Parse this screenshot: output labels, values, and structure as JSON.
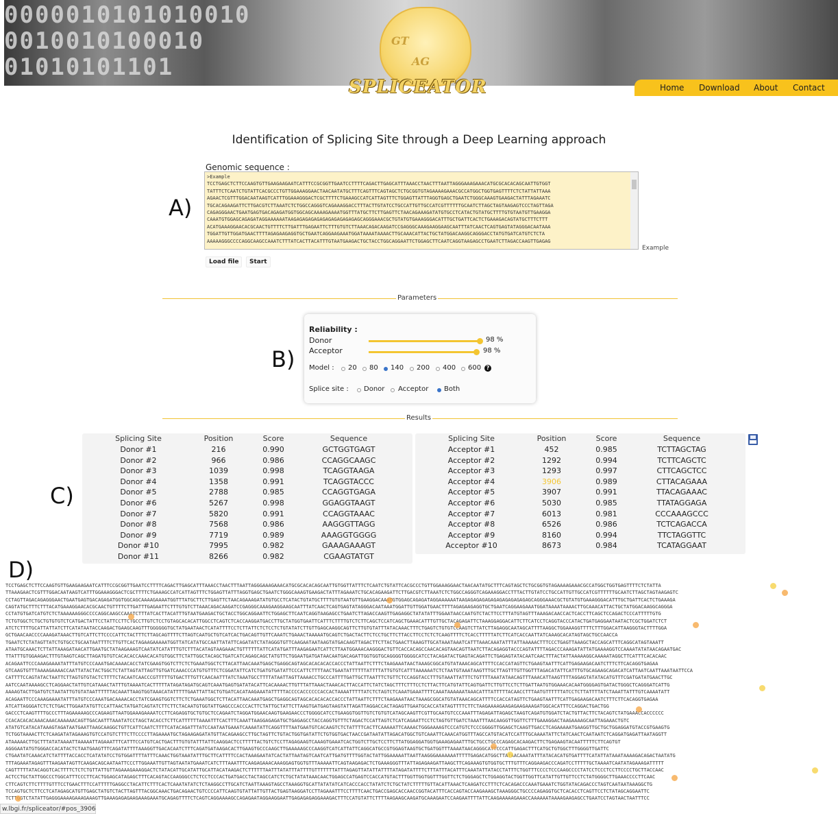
{
  "header": {
    "binary_lines": [
      "0000010101010010",
      "0010010100010",
      "01010101101"
    ],
    "logo_top": "GT",
    "logo_mid": "AG",
    "logo_text": "SPLICEATOR",
    "nav": [
      "Home",
      "Download",
      "About",
      "Contact"
    ],
    "colors": {
      "nav_bar": "#f8c21c"
    }
  },
  "title": "Identification of Splicing Site through a Deep Learning approach",
  "input": {
    "label": "Genomic sequence :",
    "value": ">Example\nTCCTGAGCTCTTCCAAGTGTTGAAGAAGAATCATTTCCGCGGTTGAATCCTTTTCAGACTTGAGCATTTAAACCTAACTTTAATTAGGGAAAGAAACATGCGCACACAGCAATTGTGGT\nTATTTCTCAATCTGTATTCACGCCCTGTTGGAAAGGAACTAACAATATGCTTTCAGTTTCAGTAGCTCTGCGGTGTAGAAAAGAAACGCCATGGCTGGTGAGTTTTCTCTATTATTAAA\nAGAACTCGTTTGGACAATAAGTCATTTGGAAAGGGACTCGCTTTTCTGAAAGCCATCATTAGTTTCTGGAGTTATTTAGGTGAGCTGAATCTGGGCAAAGTGAAGACTATTTAGAAATC\nTGCACAGAAGATTCTTGACGTCTTAAATCTCTGGCCAGGGTCAGAAAGGACCTTTACTTGTATCCTGCCATTGTTGCCATCGTTTTTTGCAATCTTAGCTAGTAAGAGTCCCTAGTTAGA\nCAGAGGGAACTGAATGAGTGACAGAGATGGTGGCAGCAAAAGAAAATGGTTTATGCTTCTTGAGTTCTAACAGAAAGATATGTGCCTCATACTGTATGCTTTTGTGTAATGTTGAAGGA\nCAAATGTGGAGCAGAGATAGGAAAAAATAAGAGAGAGAGAGAGAGAGAGAGAGCAGGGAAACGCTGTATGTGAAAGGGACATTTGCTGATTCACTCTGAAAGACAGTATGCTTTCTTT\nACATGAAAGGAACACGCAACTGTTTTCTTGATTTGAGAATTCTTTGTGTCTTAAACAGACAAGATCCGAGGGCAAAGAAGGAAGCAATTTATCAACTCAGTGAGTATAGGGACAATAAA\nTGGATTGTTGGATGAACTTTTAGAGAAGAGGTGCTGAATCAGGAAGAAATGGATAAAATAAAACTTGCAAACATTACTGCTATGGACAAGGCAGGGACCTATGTGATCATGTCTCTA\nAAAAAGGGCCCCAGGCAAGCCAAATCTTTATCACTTACATTTGTAATGAAGACTGCTACCTGGCAGGAATTCTGGAGCTTCAATCAGGTAAGAGCCTGAATCTTAGACCAAGTTGAGAG",
    "example_link": "Example",
    "load_button": "Load file",
    "start_button": "Start"
  },
  "parameters": {
    "section_label": "Parameters",
    "reliability_label": "Reliability :",
    "donor_label": "Donor",
    "donor_value": "98 %",
    "donor_pct": 98,
    "acceptor_label": "Acceptor",
    "acceptor_value": "98 %",
    "acceptor_pct": 98,
    "model_label": "Model :",
    "model_options": [
      "20",
      "80",
      "140",
      "200",
      "400",
      "600"
    ],
    "model_selected": "140",
    "splice_label": "Splice site :",
    "splice_options": [
      "Donor",
      "Acceptor",
      "Both"
    ],
    "splice_selected": "Both"
  },
  "results": {
    "section_label": "Results",
    "donor_headers": [
      "Splicing Site",
      "Position",
      "Score",
      "Sequence"
    ],
    "donor_rows": [
      [
        "Donor #1",
        "216",
        "0.990",
        "GCTGGTGAGT"
      ],
      [
        "Donor #2",
        "966",
        "0.986",
        "CCAGGCAAGC"
      ],
      [
        "Donor #3",
        "1039",
        "0.998",
        "TCAGGTAAGA"
      ],
      [
        "Donor #4",
        "1358",
        "0.991",
        "TCAGGTACCC"
      ],
      [
        "Donor #5",
        "2788",
        "0.985",
        "CCAGGTGAGA"
      ],
      [
        "Donor #6",
        "5267",
        "0.998",
        "GGAGGTAAGT"
      ],
      [
        "Donor #7",
        "5820",
        "0.991",
        "CCAGGTAAAC"
      ],
      [
        "Donor #8",
        "7568",
        "0.986",
        "AAGGGTTAGG"
      ],
      [
        "Donor #9",
        "7719",
        "0.989",
        "AAAGGTGGGG"
      ],
      [
        "Donor #10",
        "7995",
        "0.982",
        "GAAAGAAAGT"
      ],
      [
        "Donor #11",
        "8266",
        "0.982",
        "CGAAGTATGT"
      ]
    ],
    "acceptor_headers": [
      "Splicing Site",
      "Position",
      "Score",
      "Sequence"
    ],
    "acceptor_rows": [
      [
        "Acceptor #1",
        "452",
        "0.985",
        "TCTTAGCTAG"
      ],
      [
        "Acceptor #2",
        "1292",
        "0.994",
        "TCTTCAGCTC"
      ],
      [
        "Acceptor #3",
        "1293",
        "0.997",
        "CTTCAGCTCC"
      ],
      [
        "Acceptor #4",
        "3906",
        "0.989",
        "CTTACAGAAA"
      ],
      [
        "Acceptor #5",
        "3907",
        "0.991",
        "TTACAGAAAC"
      ],
      [
        "Acceptor #6",
        "5030",
        "0.985",
        "TTATAGGAGA"
      ],
      [
        "Acceptor #7",
        "6013",
        "0.981",
        "CCCAAAGCCC"
      ],
      [
        "Acceptor #8",
        "6526",
        "0.986",
        "TCTCAGACCA"
      ],
      [
        "Acceptor #9",
        "8160",
        "0.994",
        "TTCTAGGTTC"
      ],
      [
        "Acceptor #10",
        "8673",
        "0.984",
        "TCATAGGAAT"
      ]
    ],
    "highlight_color": "#f3c531"
  },
  "annotations": {
    "a": "A)",
    "b": "B)",
    "c": "C)",
    "d": "D)"
  },
  "dna_lines": [
    "TCCTGAGCTCTTCCAAGTGTTGAAGAAGAATCATTTCCGCGGTTGAATCCTTTTCAGACTTGAGCATTTAAACCTAACTTTAATTAGGGAAAGAAACATGCGCACACAGCAATTGTGGTTATTTCTCAATCTGTATTCACGCCCTGTTGGAAAGGAACTAACAATATGCTTTCAGTAGCTCTGCGGTGTAGAAAAGAAACGCCATGGCTGGTGAGTTTTCTCTATTA",
    "TTAAAGAACTCGTTTGGACAATAAGTCATTTGGAAAGGGACTCGCTTTTCTGAAAGCCATCATTAGTTTCTGGAGTTATTTAGGTGAGCTGAATCTGGGCAAAGTGAAGACTATTTAGAAATCTGCACAGAAGATTCTTGACGTCTTAAATCTCTGGCCAGGGTCAGAAAGGACCTTTACTTGTATCCTGCCATTGTTGCCATCGTTTTTTGCAATCTTAGCTAGTAAGAGTC",
    "CCTAGTTAGACAGAGGGAACTGAATGAGTGACAGAGATGGTGGCAGCAAAAGAAAATGGTTTATGCTTCTTGAGTTCTAACAGAAAGATATGTGCCTCATACTGTATGCTTTTGTGTAATGTTGAAGGACAAATGTGGAGCAGAGATAGGAAAAAATAAGAGAGAGAGAGAGAGAGAGAGAGCAGGGAAACGCTGTATGTGAAAGGGACATTTGCTGATTCACTCTGAAAGA",
    "CAGTATGCTTTCTTTACATGAAAGGAACACGCAACTGTTTTCTTGATTTGAGAATTCTTTGTGTCTTAAACAGACAAGATCCGAGGGCAAAGAAGGAAGCAATTTATCAACTCAGTGAGTATAGGGACAATAAATGGATTGTTGGATGAACTTTTAGAGAAGAGGTGCTGAATCAGGAAGAAATGGATAAAATAAAACTTGCAAACATTACTGCTATGGACAAGGCAGGGA",
    "CCTATGTGATCATGTCTCTAAAAAAGGGCCCCAGGCAAGCCAAATCTTTATCACTTACATTTGTAATGAAGACTGCTACCTGGCAGGAATTCTGGAGCTTCAATCAGGTAAGAGCCTGAATCTTAGACCAAGTTGAGAGGCTATATATTTGGAATAACCAATGTCTACTTCCTTTATGTAGTTTAAAGACAACCACTCACCTTCAGCTCCAGACTCCCATTTTTGTG",
    "TCTGTGGCTCTGCTGTGTGTCTCATGACTATTCCTATTCCTTCTGCCTTGTCTCCTGTAGCACACATTGGCCTCAGTCTCACCAAGGATGACCTTGCTATGGTGAATTCATTTCTTTTGTCTCTTCAGCTCCATCAGCTGAAACATTTGTTGCTACAGAGATTCTAAAGGAGGACATTCTTCATCCTCAGGTACCCATACTGATGAGGAATAATACTCGCTGGATCTCT",
    "ATCTCTTTTGCATTATTATCTTCATATAATACCAAGACTGAAGCAAGTTTGGGGGGTGCTATGAATAACTCATATTTTCCTCTTATTCTCTCCTCTGTATATCTTGTTGAGCAAGGCAGTTCTTGTGTATTTATACAAACTTTCTGAGTCTGTGTCCAAGTCTTATCTTAGAGGCAATAGCATTTTAAGGCTGGAAAGGTTTTCTTTGGACATTAAGGGTACTTTTGGA",
    "GCTGAACAACCCCAAAGATAAACTTGTCATTCTTCCCCATTCTACTTTCTTAGCAGTTTTCTTAGTCAATGCTGTCATCACTGACAGTTGTTCAAATCTGAAACTAAAAATGCAGTCTGACTACTTCTCCTGCTTCTTACCTTCCTCTCTCAAGTTTTCTCACCTTTTTATCTTCATCACCAATTATCAAAGCACATAGTAGCTGCCAACCA",
    "TGAATCTCTATAGTTATCTGTGCCTGCAATAATTTTCTTGTTCACTAGAAGAAAAATGGTTATCATATGCCAATTATATTCAGATATCTATAGGGTGTTCAAGAATAATAAGTATGACAAGTTAGACTTCTTACTGAACTTAAAGTTGCATAAATAAATCATTTAAACAAATATTTATTAAAAACTTTCCCTGAGTTAAAGCTACCAGCATTTCAGGCATAGTAAATT",
    "ATAATGCAAACTCTTATTAAAGATAACATTGAATGCTATAAGAAAGTCAATATCATATTTGTCTTTACATAGTAAGAAACTGTTTTTTATTCATATGATTTAAGAGAATCATTCTTAATGGAAACAAGGGACTGTTCACCACAGCCAACACAGTAACAGTTAATCTTACAGAGGTACCCAGTATTTTAGACCCAAAGATATTATGAAAAGGTCCAAAATATATAACAGAATGAC",
    "TTATTTGTGGAAGACTTTGTAAGTCAGCTTAGATGTGTCACACACCAAACACATGTGGCTTCTATTGGCTACAGCTGATCATCAGAGCAGCTATGTTCTGGAATGATGATAACAATGACAGATTGGTGGTGCAGGGGTGGGGCATCCTACAGATACTGAGTACAGATTCTGAGAGTATACAATCAACTTTACTATTAAAAAGGCAAAAATAGGCTTCATTTCACACAAC",
    "ACAGAATTCCCAAAGAAAATATTTATGTCCCAAATGACAAAACACCTATCGAAGTGGTCTTCTCTGAAATGGCTCTTACATTAACAAATGAGCTGAGGCAGTAGCACACACACCACCCTATTAATTCTTTCTAAGAAATAACTAAAGCGGCATGTATAAACAGCATTTTCCACCATAGTTCTGAAGTAATTTCATTGAGAAGACAATCTTTCTTCACAGGTGAGAA",
    "GTCAAGTGTTTAAAAGAAAACCAATTATACTACTGGCTCTATTAGTATTAGTTGTGATCAAACCCATGTGTTTCTCGGATATTCATCTGATGTGATATTCCCATTCTTTTAACTGAATATTTTTTATTTTATTGTGTCATTTAAAAAATCTCTAATGTAAATAAGTTTGCTTAGTTTGTTGGTTTAGACATATTCATTTGTGCAGAAGCAGACATCATTAATCAATTAAATAATTCCA",
    "CATTTTCCAGTATACTAATTCTTAGTGTGTACTCTTTTCTACAATCAACCCGTTTTTGTGACTTTGTTCAACAATTTATCTAAATGCCTTTTATAATTAGTTAAAACCTGCCCATTTTGATTGCTTAATTTCTGTTCTCCAGGTACCTTTGTAAATTATTTCTGTTTTAAATATAACAGTTTAAACATTAAGTTTTAGGAGTATATACATGTTTCGATGATATGAACTTGC",
    "AATCCAATAAAAGCCTCAGGAACTATTGTCATAAACTATTTGTAAAATCACTTTTTATAGATAGATGCAGTCAAATGAGTGATATACATTCACAAAACTTGTTTATTAAACTAAACACTTACCATTCTATCTAGCTTTCTTTCCTCTTACTTCATGTATTCAGTGATTCTTGTTCCTCTTGATTAATGTGGAAACACAATGGGGAGTGATACTGGGCTCAGGGATCATTG",
    "AAAAGTACTTGATGTCTAATATTGTGTATAATTTTTTACAAATTAAGTGGTAAACATATTTTTGAATTATTACTGTGATCACATAAGAAATATTTTTACCCCACCCCCCACCACTAAAATTTTTATCTCTAGTCTCAAATGAAATTTTCAAATAAAAAATAAACATTTATTTTTACAACCTTTAATGTTTTTTATCCTCTTATTTTATCTAAATTATTTGTCAAAATATT",
    "ACAGAATTCCCAAAGAAAATATTTATGTCCCAAATGACAAAACACCTATCGAAGTGGTCTTCTCTGAAATGGCTCTTACATTAACAAATGAGCTGAGGCAGTAGCACACACACCACCCTATTAATTCTTTCTAAGAAATAACTAAAGCGGCATGTATAAACAGCATTTTCCACCATAGTTCTGAAGTAATTTCATTGAGAAGACAATCTTTCTTCACAGGTGAGAA",
    "ATCATTAGGGATCTCTCTGACTTGGAATATGTTCCATTAACTATGATCAGTATCTTCTTCTACAATGTGGTATTGAGCCCACCCACTTCTATTGCTATTCTTAAGTGATGAGTAAGTATTAGATTAGGACCACTAGAGTTGAATGCACCATATAGTTTTCTTCTAAGAAAAGAAGAGAAGAAAGATGGCACATTTCCAGGACTGACTGG",
    "GACCCTCAAGTTTTGCCCTTTAGAAAAAGCCCAGAAGTTAATGGAAAGAAAATCCTTCAGAGGTGCTGTGCTCCAGAATCTAGGATGGAACAAGTGAAGAACCCTGGGGCATCCTGAAGGTGGTTGTCTGTGTCATAGCAAGTTCGTTGCAATGTCCCAAATTTAGAGATTAGAGCTAAGTCAGATGTGGATCTACTGTTACTTCTACAGTCTATGAAACCACCCCCC",
    "CCACACACACAAACAAACAAAAAACAGTTGACAATTTAAATATCCTAGCTACACCTCTTCATTTTTTAAAATTTCACTTTCAAATTAAGGAGAGATGCTGAGAGCCTACCAGGTGTTTCTAGACTCCATTAGTCTCATCAGAATTCCTCTAGTGTTGATCTAAATTTAACAAGGTTGGTTCTTTGAAAGGACTAAGAAAAGCAATTAGAAACTGTC",
    "ATATGTCATACATAAAGTAGATAATGAATTAAGCAAGGCTGTTCATTCAATCTTTTCATACAGATTTATCCAATAATGAAATCAAAATATTCAGGTTTTAATGAATGTCACAAGTCTCTATTTTCACTTCAAAAATTCAAAACTGGGAAAAGTCCCATGTCTCCCGGGGTTGGAGCTCAAGTTGACCTCAGAAAAATGAAGGTTGCTGCTGGAGGATGTACCGTGAAGTG",
    "TCTGGTAAAACTTCTCAAGATATAGAAAGTGTCCATGTCTTTCTTCCCCTTAGAAAATGCTAGAAGAGATATGTTACAGAAGCCTTGCTAGTTCTGTACTGGTGATATTCTGTGGTGACTAACCGATAATATTAGACATGGCTGTCAAATTCAAACATGGTTTAGCCATGTACATCCATTTGCAAAATATTCTATCAACTCAATAATCTCAGGATGAGATTAATAGGTT",
    "ATAAAAACTTGCTTTATATAAAATTAAAAATTAGAAATTTCATTTCCATGTCACTGACTTTGTGTATTTATTCAAGGACTCCTTTTTACTGTCTCCTTAGAGAAGTCAAAGTGAAATCACTGGTCTTGCTCCTTCTTATGGAGGATGGTGAAAGAGAATTTGCTGCCTGCCCAGAGCACAAGACTTCTGAGAAGTACAATTTTTCTTCAGTGT",
    "AGGGAATATGTGGGACCACATACTCTAATGAAGTTTCAGATATTTTAAAGGTTGACACAATCTTTCAGATGATAAGACACTTGAAGTGCCCAAGCTTGAAAAAGCCCAAGGTCATCATTATTCAGGCATGCCGTGGAGTAAGTGCTGATGGTTTAAAATAACAGGGCATTCCCATTGAGACTTTCATGCTGTGGCTTTGGGGTTGATTC",
    "CTGAATATCAAACATCTATTTTACCACCTCATATATCCTGTGGATTTTATTTCAAACTGGTAAATATTTGCTTCATTTTCCACTAAAGAATATCACTATTAATAGTCAATCATTGATGTTTTGGTACTATTGGAAAAATTAATTAAGGGAAAAAAATTTTTGAGACATGGCTTATAACAAATATTTATACACATGTGATTTTCATATTATAAATAAAAGACAGACTAATATG",
    "TTTAGAAATAGAGTTTAAGAATAGTTCAAGACAGCAATAATTCCCTTGGAAATTGTTAGTAATATGAAATCATCTTTAAATTTCAAGAGAAACAAAGGAGTGGTGTTTAAAAATTCAGTAAGAGACTCTGAAAGGGTTTATTAGAGAAGATTAAGCTTCAGAAAGTGTGGTGCTTTGTTTCAGGAAGACCCAGATCCTTTTTGCTAAAATCAATATAGAAAGATTTTT",
    "CAGTTTTTATACAGGTCACTTTTCTCTCTGTTATTGTTAGAAAGAAAGGACTCTATACATTGCATATTGCATTACATAAGACTCTTTTTTAATTTATATTTATTTTGTTTTTTTATTTAGAGTTATATTATTTTATAGATATTTTCTTTATTTACATTTCAAATATTATACCTATTTCTGGTTTCCCCTCCCAAGCCCCTATCCTCCCTCCTTCCCCTGCTTACCAAC",
    "ACTCCTGCTATTGGCCCTGGCATTTCCCTTCACTGGAGCATAGAGCTTTCACAGTACCAAGGGCCTCTCCTCCCACTGATGACCTACTAGCCATCTCTGCTATATAAACAACTGGAGCCATGAGTCCACCATGTACTTTGGTTGGTGGTTTGGTTCTCTGGGAGCTCTGGAGGTACTGGTTGGTTCATATTGTTGTTCCTCTATGGGGCTTGAAACCCCTTCAAC",
    "CTTCAGTCTTCTTTTGTTTCCTGAACTTTCCATTTTTGAGGCCTACATTCTTTCACTCAAATATATCTCTAAGGCCTTGCATCTAATTAAAGTAGCCTAAAGGTGCATTATATATCATCACCCACCTATATCTCTGCTATCTTTTTGTTACATTAAACTCAAGATCCTTTCTCACAGACCCAAATGAAATCTGGTATACAGACCCTAGTCAATAATAAAGGCTG",
    "TCCAGTGCTCTTCCTCATAGAGCATGTTGAGCTATGTCTACTTAGTTTACGGCAAACTGACAGAACTGTCCCCATTCAAGTGTATTATTGTTACTGAGTAAGGATCCTTAGAAATTTCCTTTTCAACTGACCGAGCACCAACCGGTACATTTCACCAGTACCAAGAAAGCTAAAGGGCTGCCCCAGAGGTGCTCACACCTCAGTTCCTCTATAGCAGGAATTC",
    "TCTTGGTCTATATTGAGGGAAAAGAAAGAAAGTTGAAAGAGAGAAGAAAGAAATGCAGAGTTTTCTCAGTCAGGAAAAGCCAGAGAATAGGAAGGAATTGAGAGAGAGGAAAGACTTTCCATGTATTCTTTTAAGAAGCAAGATGCAAAGAATCCAAGAATTTTATTCAAGAAAAAGAAACCAAAAAATAAAAGAAGAGCCTGAATCCTAGTAACTAATTTCC"
  ],
  "status_url": "w.lbgi.fr/spliceator/#pos_3906"
}
